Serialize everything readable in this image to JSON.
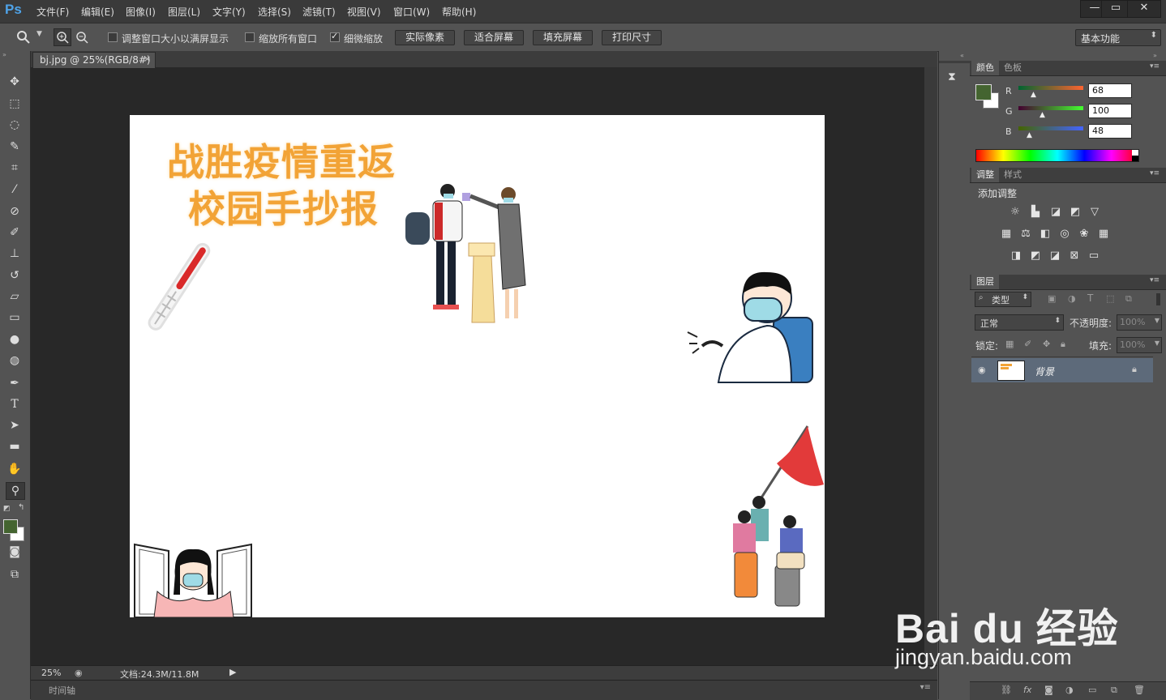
{
  "app": {
    "logo": "Ps",
    "menus": [
      "文件(F)",
      "编辑(E)",
      "图像(I)",
      "图层(L)",
      "文字(Y)",
      "选择(S)",
      "滤镜(T)",
      "视图(V)",
      "窗口(W)",
      "帮助(H)"
    ],
    "window_controls": [
      "—",
      "▭",
      "✕"
    ]
  },
  "options": {
    "checkboxes": [
      {
        "label": "调整窗口大小以满屏显示",
        "checked": false
      },
      {
        "label": "缩放所有窗口",
        "checked": false
      },
      {
        "label": "细微缩放",
        "checked": true
      }
    ],
    "buttons": [
      "实际像素",
      "适合屏幕",
      "填充屏幕",
      "打印尺寸"
    ],
    "workspace": "基本功能"
  },
  "document": {
    "tab_title": "bj.jpg @ 25%(RGB/8#)",
    "tab_close": "×",
    "zoom": "25%",
    "doc_size": "文档:24.3M/11.8M",
    "timeline_label": "时间轴",
    "canvas_title_line1": "战胜疫情重返",
    "canvas_title_line2": "校园手抄报"
  },
  "color_panel": {
    "tabs": [
      "颜色",
      "色板"
    ],
    "channels": [
      {
        "label": "R",
        "value": "68"
      },
      {
        "label": "G",
        "value": "100"
      },
      {
        "label": "B",
        "value": "48"
      }
    ],
    "foreground": "#446430",
    "background": "#ffffff"
  },
  "adjust_panel": {
    "tabs": [
      "调整",
      "样式"
    ],
    "heading": "添加调整"
  },
  "layers_panel": {
    "tabs": [
      "图层"
    ],
    "filter": "类型",
    "blend_mode": "正常",
    "opacity_label": "不透明度:",
    "opacity_value": "100%",
    "lock_label": "锁定:",
    "fill_label": "填充:",
    "fill_value": "100%",
    "layer_name": "背景"
  },
  "watermark": {
    "main": "Bai du 经验",
    "sub": "jingyan.baidu.com"
  }
}
